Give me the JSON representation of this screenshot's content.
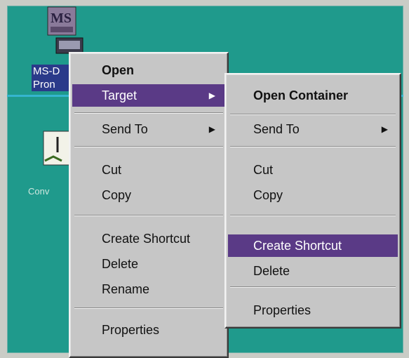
{
  "desktop": {
    "msdos_label": "MS-D",
    "msdos_label2": "Pron",
    "note_label": "Conv"
  },
  "context_menu": {
    "items": [
      {
        "label": "Open",
        "bold": true
      },
      {
        "label": "Target",
        "selected": true,
        "submenu": true
      },
      {
        "label": "Send To",
        "submenu": true
      },
      {
        "label": "Cut"
      },
      {
        "label": "Copy"
      },
      {
        "label": "Create Shortcut"
      },
      {
        "label": "Delete"
      },
      {
        "label": "Rename"
      },
      {
        "label": "Properties"
      }
    ]
  },
  "target_submenu": {
    "items": [
      {
        "label": "Open Container",
        "bold": true
      },
      {
        "label": "Send To",
        "submenu": true
      },
      {
        "label": "Cut"
      },
      {
        "label": "Copy"
      },
      {
        "label": "Create Shortcut",
        "selected": true
      },
      {
        "label": "Delete"
      },
      {
        "label": "Properties"
      }
    ]
  },
  "colors": {
    "desktop": "#1f9a8c",
    "menu_bg": "#c6c6c6",
    "highlight": "#5a3a86"
  },
  "icons": {
    "submenu_arrow": "triangle-right-icon"
  }
}
